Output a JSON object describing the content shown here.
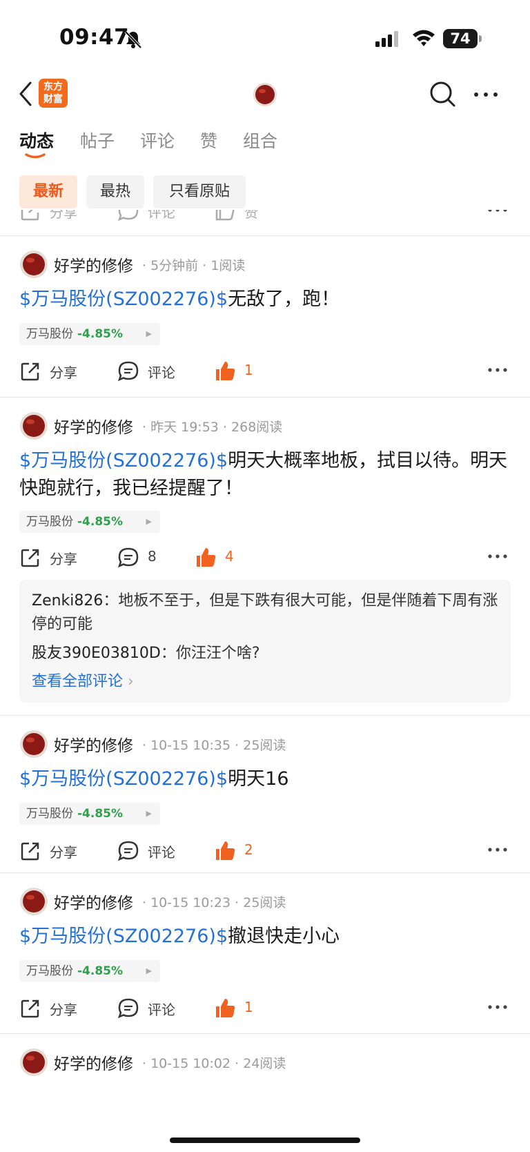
{
  "status_bar": {
    "time": "09:47",
    "battery": "74"
  },
  "nav": {
    "logo_line1": "东方",
    "logo_line2": "财富"
  },
  "tabs": [
    {
      "label": "动态"
    },
    {
      "label": "帖子"
    },
    {
      "label": "评论"
    },
    {
      "label": "赞"
    },
    {
      "label": "组合"
    }
  ],
  "filters": [
    {
      "label": "最新"
    },
    {
      "label": "最热"
    },
    {
      "label": "只看原贴"
    }
  ],
  "partial_actions": {
    "share": "分享",
    "comment": "评论",
    "like": "赞"
  },
  "posts": [
    {
      "author": "好学的修修",
      "time": "5分钟前",
      "reads": "1阅读",
      "stock_link": "$万马股份(SZ002276)$",
      "text": "无敌了，跑！",
      "tag_name": "万马股份",
      "tag_pct": "-4.85%",
      "share": "分享",
      "comment": "评论",
      "likes": "1"
    },
    {
      "author": "好学的修修",
      "time": "昨天 19:53",
      "reads": "268阅读",
      "stock_link": "$万马股份(SZ002276)$",
      "text": "明天大概率地板，拭目以待。明天快跑就行，我已经提醒了！",
      "tag_name": "万马股份",
      "tag_pct": "-4.85%",
      "share": "分享",
      "comment": "8",
      "likes": "4",
      "comments": [
        {
          "user": "Zenki826",
          "text": "地板不至于，但是下跌有很大可能，但是伴随着下周有涨停的可能"
        },
        {
          "user": "股友390E03810D",
          "text": "你汪汪个啥?"
        }
      ],
      "view_all": "查看全部评论"
    },
    {
      "author": "好学的修修",
      "time": "10-15 10:35",
      "reads": "25阅读",
      "stock_link": "$万马股份(SZ002276)$",
      "text": "明天16",
      "tag_name": "万马股份",
      "tag_pct": "-4.85%",
      "share": "分享",
      "comment": "评论",
      "likes": "2"
    },
    {
      "author": "好学的修修",
      "time": "10-15 10:23",
      "reads": "25阅读",
      "stock_link": "$万马股份(SZ002276)$",
      "text": "撤退快走小心",
      "tag_name": "万马股份",
      "tag_pct": "-4.85%",
      "share": "分享",
      "comment": "评论",
      "likes": "1"
    },
    {
      "author": "好学的修修",
      "time": "10-15 10:02",
      "reads": "24阅读"
    }
  ],
  "colors": {
    "accent": "#f0621f",
    "link": "#2470d8",
    "down_green": "#2da24b"
  }
}
